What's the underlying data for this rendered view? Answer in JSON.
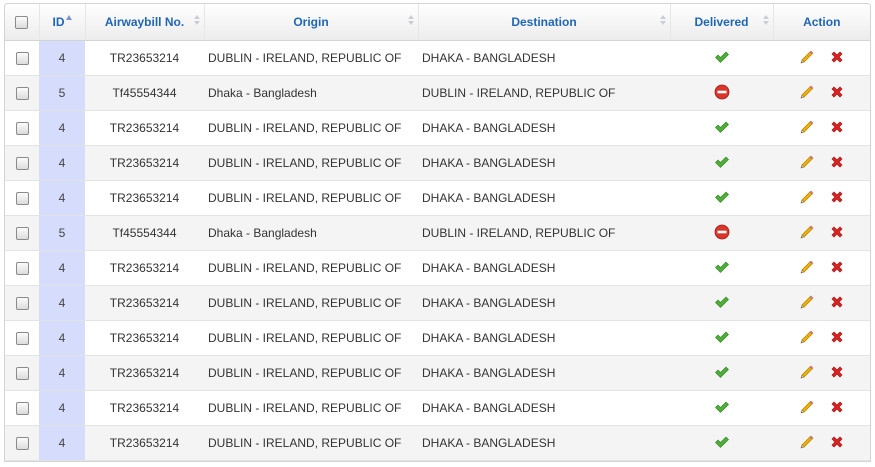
{
  "table": {
    "columns": {
      "id": "ID",
      "airwaybill": "Airwaybill No.",
      "origin": "Origin",
      "destination": "Destination",
      "delivered": "Delivered",
      "action": "Action"
    },
    "rows": [
      {
        "id": "4",
        "airwaybill": "TR23653214",
        "origin": "DUBLIN - IRELAND, REPUBLIC OF",
        "destination": "DHAKA - BANGLADESH",
        "delivered": true
      },
      {
        "id": "5",
        "airwaybill": "Tf45554344",
        "origin": "Dhaka - Bangladesh",
        "destination": "DUBLIN - IRELAND, REPUBLIC OF",
        "delivered": false
      },
      {
        "id": "4",
        "airwaybill": "TR23653214",
        "origin": "DUBLIN - IRELAND, REPUBLIC OF",
        "destination": "DHAKA - BANGLADESH",
        "delivered": true
      },
      {
        "id": "4",
        "airwaybill": "TR23653214",
        "origin": "DUBLIN - IRELAND, REPUBLIC OF",
        "destination": "DHAKA - BANGLADESH",
        "delivered": true
      },
      {
        "id": "4",
        "airwaybill": "TR23653214",
        "origin": "DUBLIN - IRELAND, REPUBLIC OF",
        "destination": "DHAKA - BANGLADESH",
        "delivered": true
      },
      {
        "id": "5",
        "airwaybill": "Tf45554344",
        "origin": "Dhaka - Bangladesh",
        "destination": "DUBLIN - IRELAND, REPUBLIC OF",
        "delivered": false
      },
      {
        "id": "4",
        "airwaybill": "TR23653214",
        "origin": "DUBLIN - IRELAND, REPUBLIC OF",
        "destination": "DHAKA - BANGLADESH",
        "delivered": true
      },
      {
        "id": "4",
        "airwaybill": "TR23653214",
        "origin": "DUBLIN - IRELAND, REPUBLIC OF",
        "destination": "DHAKA - BANGLADESH",
        "delivered": true
      },
      {
        "id": "4",
        "airwaybill": "TR23653214",
        "origin": "DUBLIN - IRELAND, REPUBLIC OF",
        "destination": "DHAKA - BANGLADESH",
        "delivered": true
      },
      {
        "id": "4",
        "airwaybill": "TR23653214",
        "origin": "DUBLIN - IRELAND, REPUBLIC OF",
        "destination": "DHAKA - BANGLADESH",
        "delivered": true
      },
      {
        "id": "4",
        "airwaybill": "TR23653214",
        "origin": "DUBLIN - IRELAND, REPUBLIC OF",
        "destination": "DHAKA - BANGLADESH",
        "delivered": true
      },
      {
        "id": "4",
        "airwaybill": "TR23653214",
        "origin": "DUBLIN - IRELAND, REPUBLIC OF",
        "destination": "DHAKA - BANGLADESH",
        "delivered": true
      }
    ]
  },
  "icons": {
    "delivered_true": "check-icon",
    "delivered_false": "no-entry-icon",
    "edit": "pencil-icon",
    "delete": "delete-icon"
  },
  "colors": {
    "header_text": "#1f66b5",
    "id_column_bg": "#d6dcfc",
    "check_green": "#4caf37",
    "no_entry_red": "#d9352b",
    "delete_red": "#dd2222",
    "pencil_yellow": "#f0b400"
  }
}
